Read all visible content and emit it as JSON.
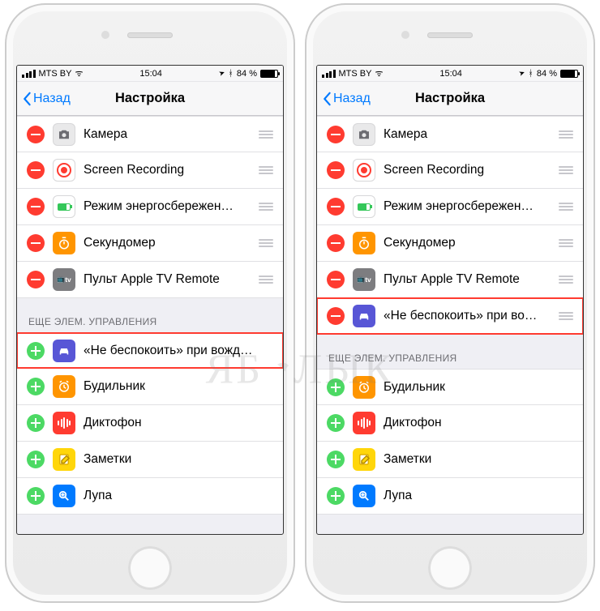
{
  "status": {
    "carrier": "MTS BY",
    "wifi_glyph": "ᯤ",
    "time": "15:04",
    "loc_glyph": "➤",
    "bt_glyph": "ᚼ",
    "battery_pct": "84 %"
  },
  "nav": {
    "back": "Назад",
    "title": "Настройка"
  },
  "section_more": "ЕЩЕ ЭЛЕМ. УПРАВЛЕНИЯ",
  "items": {
    "camera": "Камера",
    "screenrec": "Screen Recording",
    "power": "Режим энергосбережен…",
    "stopwatch": "Секундомер",
    "tv": "Пульт Apple TV Remote",
    "dnd_long": "«Не беспокоить» при вожд…",
    "dnd_short": "«Не беспокоить» при во…",
    "alarm": "Будильник",
    "voice": "Диктофон",
    "notes": "Заметки",
    "mag": "Лупа"
  },
  "tv_glyph": "📺tv",
  "watermark": {
    "a": "ЯБ",
    "b": "ЛЫК"
  }
}
